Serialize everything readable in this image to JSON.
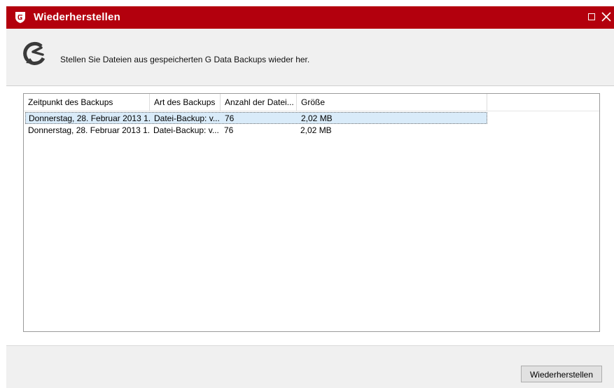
{
  "window": {
    "title": "Wiederherstellen",
    "accent_color": "#b3000d",
    "logo_icon": "gdata-shield-icon",
    "maximize_icon": "maximize-icon",
    "close_icon": "close-icon"
  },
  "header": {
    "icon": "restore-arrow-icon",
    "description": "Stellen Sie Dateien aus gespeicherten G Data Backups wieder her."
  },
  "table": {
    "columns": [
      "Zeitpunkt des Backups",
      "Art des Backups",
      "Anzahl der Datei...",
      "Größe"
    ],
    "rows": [
      {
        "time": "Donnerstag, 28. Februar 2013 1...",
        "type": "Datei-Backup: v...",
        "count": "76",
        "size": "2,02 MB",
        "selected": true
      },
      {
        "time": "Donnerstag, 28. Februar 2013 1...",
        "type": "Datei-Backup: v...",
        "count": "76",
        "size": "2,02 MB",
        "selected": false
      }
    ]
  },
  "footer": {
    "restore_button": "Wiederherstellen"
  }
}
